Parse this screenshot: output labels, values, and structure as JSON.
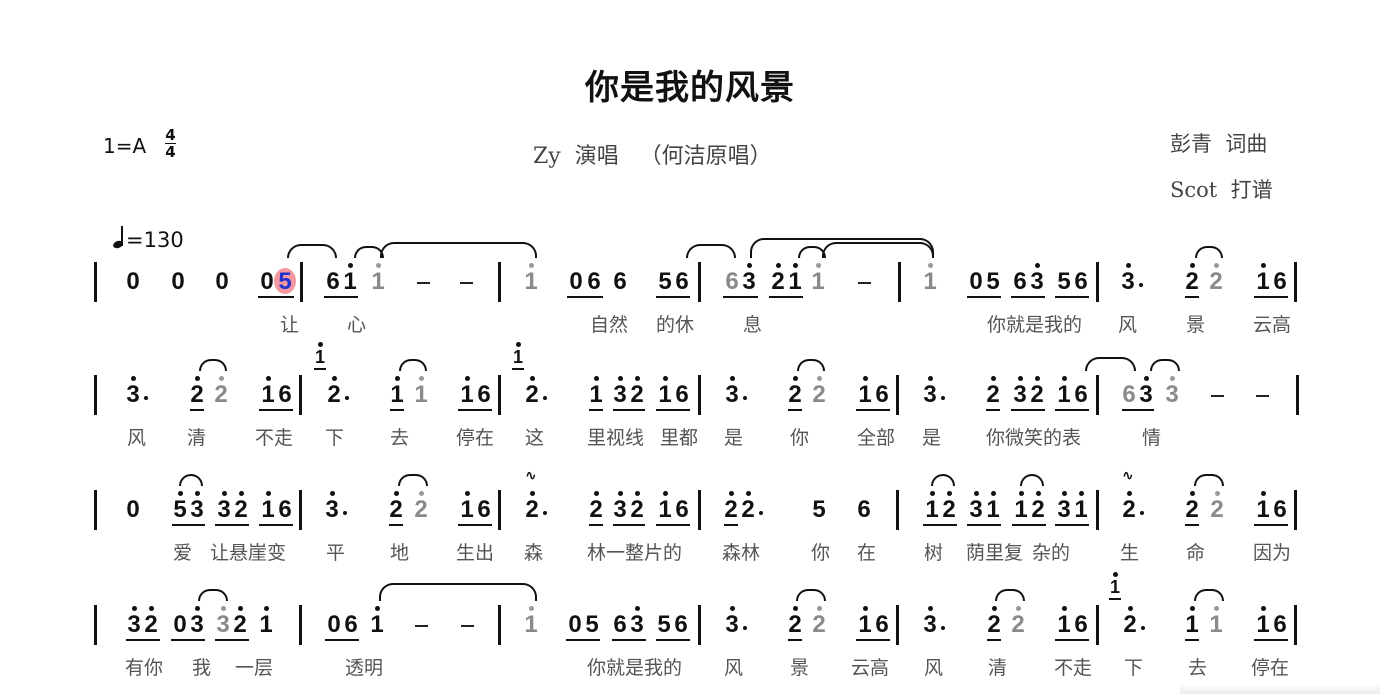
{
  "title": "你是我的风景",
  "key_signature": "1=A",
  "time_signature": {
    "numerator": "4",
    "denominator": "4"
  },
  "performer_line": "Zy  演唱   （何洁原唱）",
  "credits": [
    "彭青  词曲",
    "Scot  打谱"
  ],
  "tempo": {
    "symbol": "quarter-note",
    "text": "=130"
  },
  "playback_cursor": {
    "line": 1,
    "note": "5",
    "color": "#f06e78"
  },
  "colors": {
    "ink": "#111111",
    "tied_grey": "#8a8a8a",
    "lyric": "#555555",
    "cursor_note": "#2233cc"
  },
  "lines": [
    {
      "notation": "| 0 0 0 05 | 6i i - - | i 066 56 | 63 2i i - | i 05 63 56 | 3· 2 2 i6 |",
      "lyrics": [
        "让",
        "心",
        "自然",
        "的休",
        "息",
        "你就是我的",
        "风",
        "景",
        "云高"
      ]
    },
    {
      "notation": "| 3· 2 2 i6 | (i)2· i i i6 | (i)2· i 32 i6 | 3· 2 2 i6 | 3· 2 32 i6 | 63 3 - - |",
      "lyrics": [
        "风",
        "清",
        "不走",
        "下",
        "去",
        "停在",
        "这",
        "里视线",
        "里都",
        "是",
        "你",
        "全部",
        "是",
        "你微笑的表",
        "情"
      ]
    },
    {
      "notation": "| 0 53 32 i6 | 3· 2 2 i6 | 2· 2 32 i6 | 22· 5 6 | i2 3i i2 3i | 2· 2 2 i6 |",
      "lyrics": [
        "爱",
        "让悬崖变",
        "平",
        "地",
        "生出",
        "森",
        "林一整片的",
        "森林",
        "你",
        "在",
        "树",
        "荫里复",
        "杂的",
        "生",
        "命",
        "因为"
      ]
    },
    {
      "notation": "| 32 03 32 i | 06 i - - | i 05 63 56 | 3· 2 2 i6 | 3· 2 2 i6 | (i)2· i i i6 |",
      "lyrics": [
        "有你",
        "我",
        "一层",
        "透明",
        "你就是我的",
        "风",
        "景",
        "云高",
        "风",
        "清",
        "不走",
        "下",
        "去",
        "停在"
      ]
    }
  ]
}
